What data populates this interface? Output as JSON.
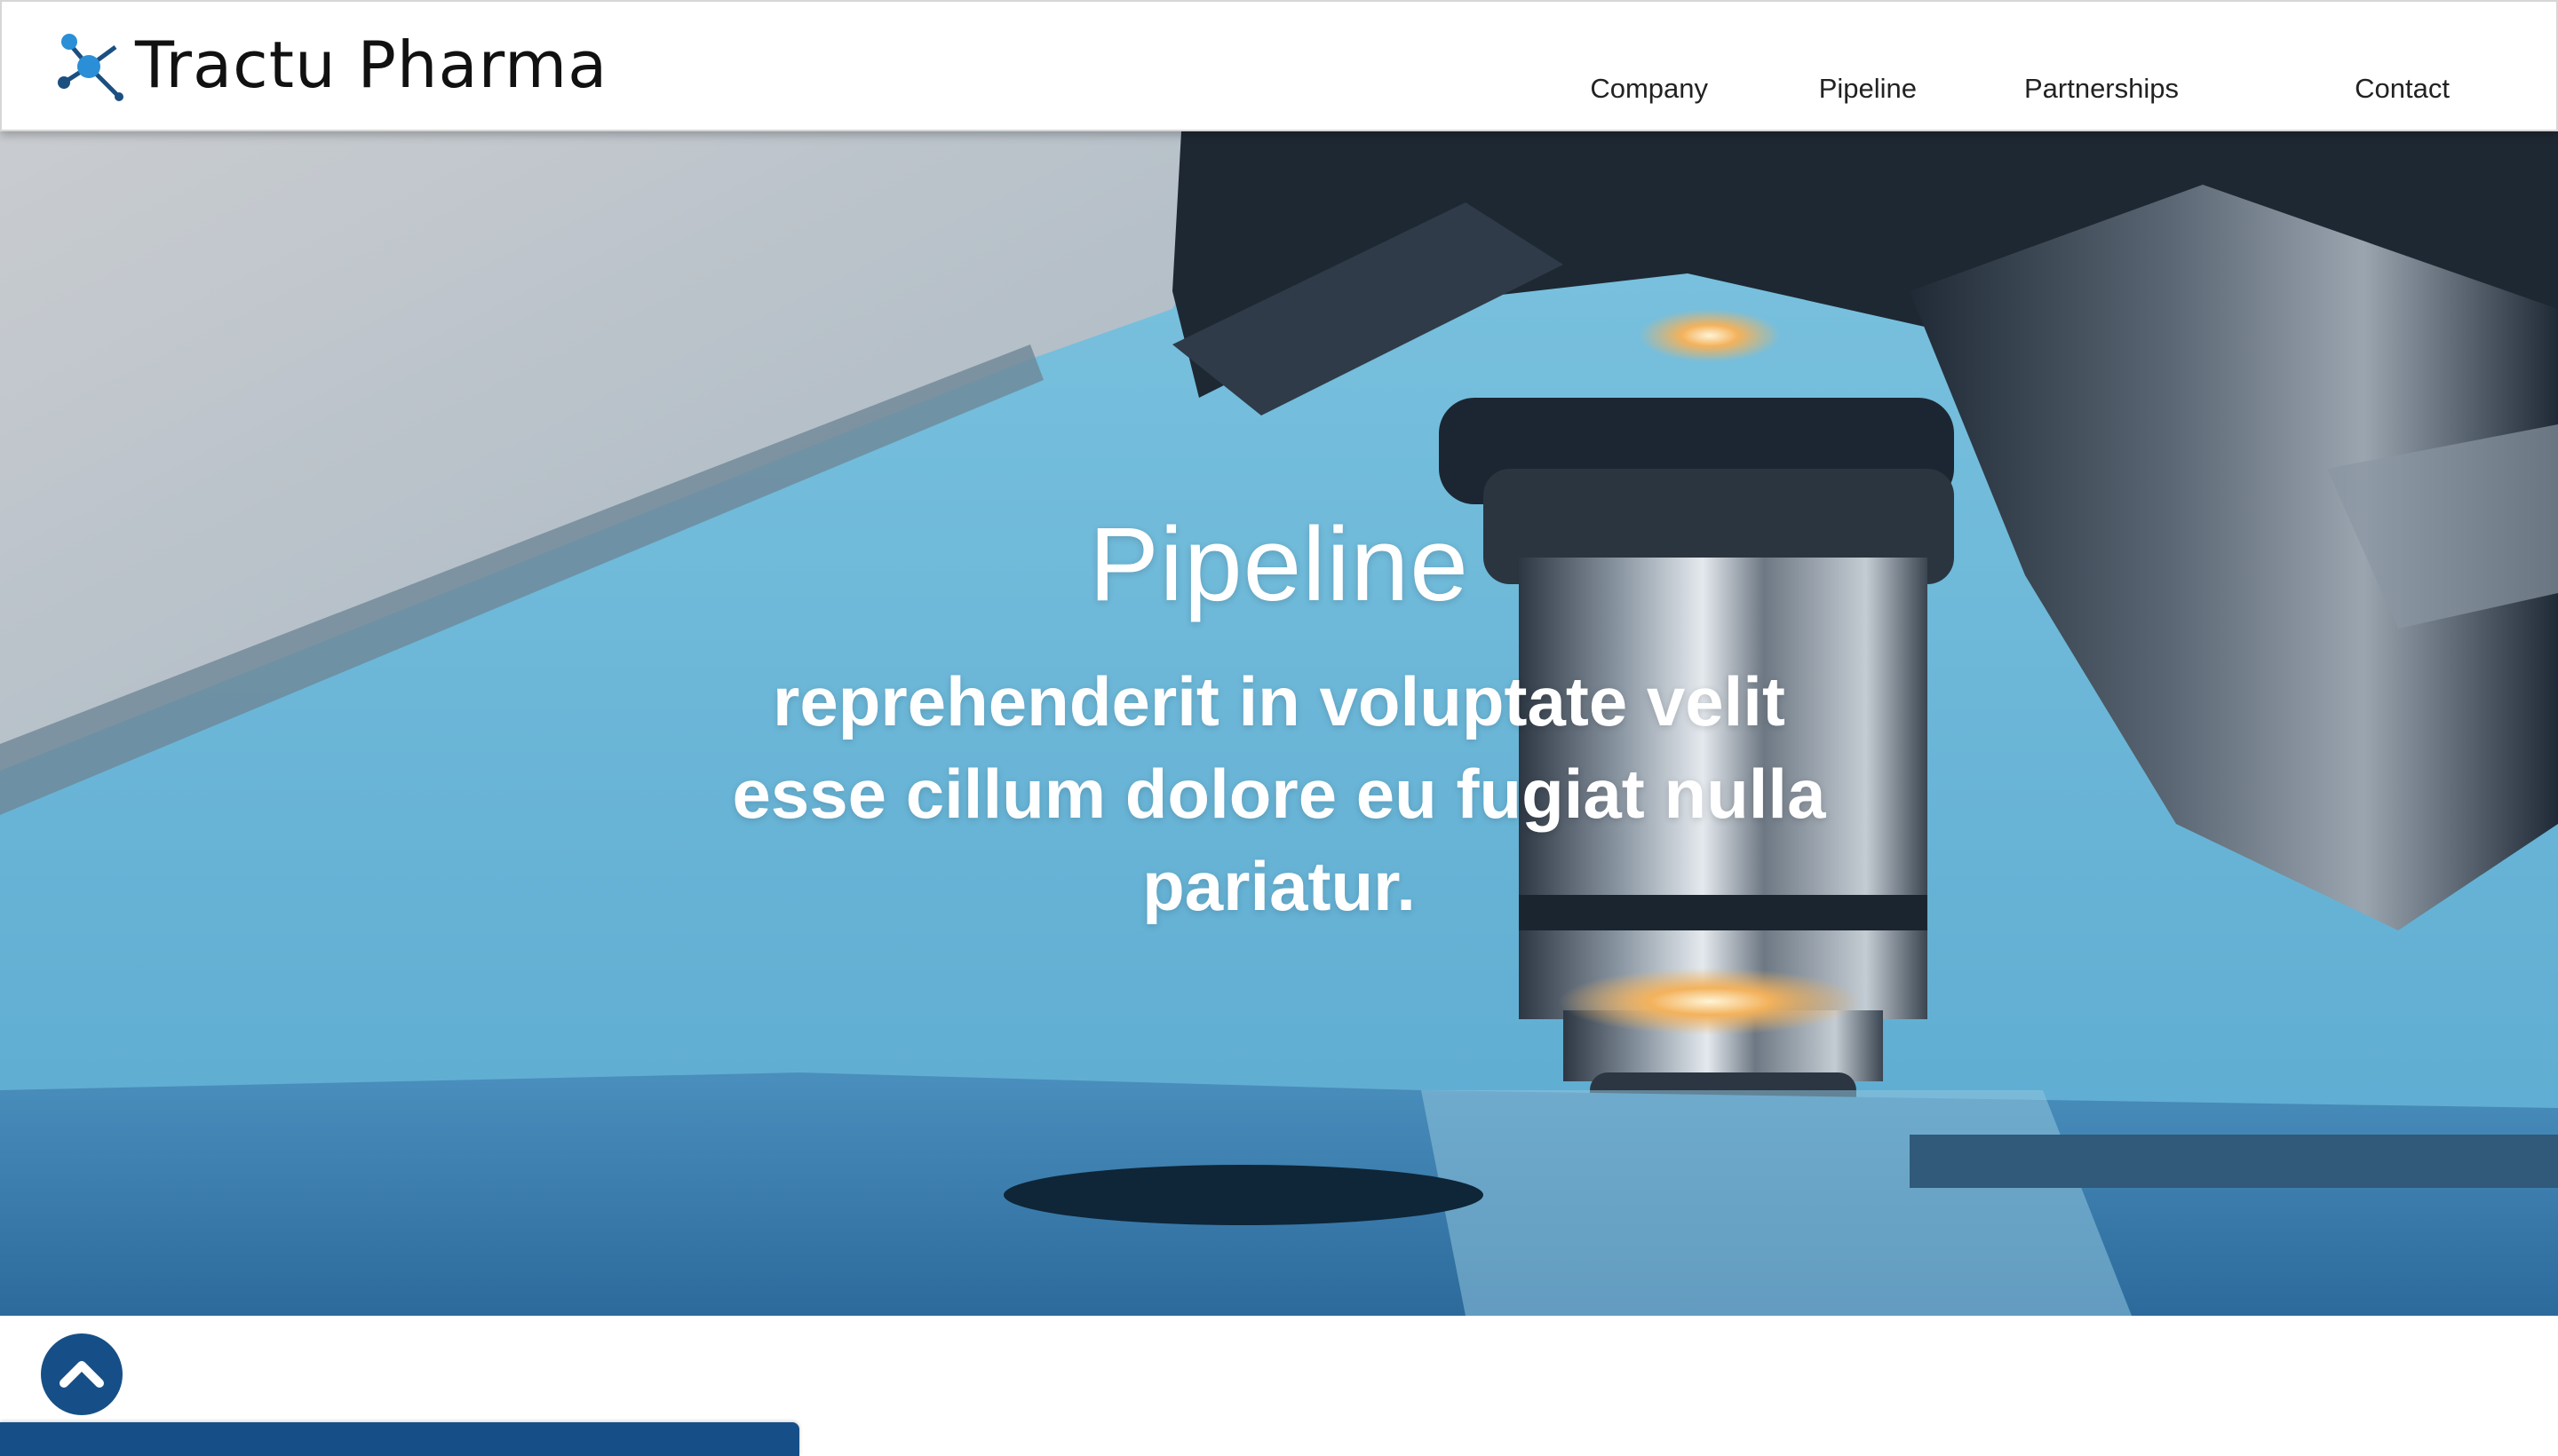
{
  "brand": {
    "name": "Tractu Pharma",
    "logo_icon": "molecule-icon",
    "accent_color": "#1a8bd0",
    "dark_blue": "#164f87"
  },
  "nav": {
    "items": [
      {
        "label": "Company"
      },
      {
        "label": "Pipeline"
      },
      {
        "label": "Partnerships"
      },
      {
        "label": "Contact"
      }
    ]
  },
  "hero": {
    "title": "Pipeline",
    "subtitle": "reprehenderit in voluptate velit esse cillum dolore eu fugiat nulla pariatur.",
    "background_image": "microscope-photo"
  },
  "scroll_top": {
    "icon": "chevron-up-icon"
  }
}
